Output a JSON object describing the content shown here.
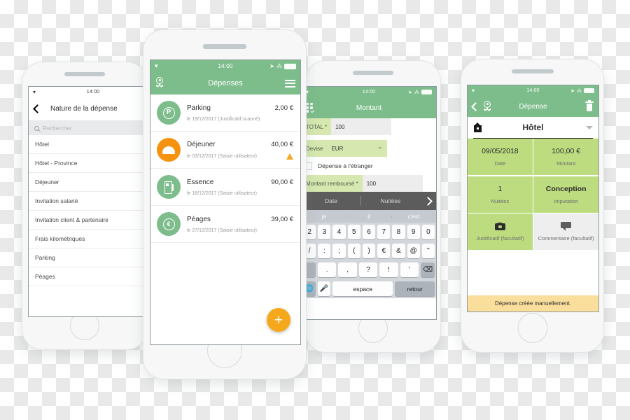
{
  "status_bar": {
    "time": "14:00",
    "wifi_icon": "wifi-icon",
    "location_icon": "location-arrow-icon",
    "bluetooth_icon": "bluetooth-icon",
    "battery_icon": "battery-full-icon"
  },
  "phone_nature": {
    "back_icon": "chevron-left-icon",
    "title": "Nature de la dépense",
    "search_icon": "search-icon",
    "search_placeholder": "Rechercher",
    "items": [
      {
        "label": "Hôtel"
      },
      {
        "label": "Hôtel - Province"
      },
      {
        "label": "Déjeuner"
      },
      {
        "label": "Invitation salarié"
      },
      {
        "label": "Invitation client & partenaire"
      },
      {
        "label": "Frais kilométriques"
      },
      {
        "label": "Parking"
      },
      {
        "label": "Péages"
      }
    ]
  },
  "phone_list": {
    "logo_icon": "app-logo-icon",
    "title": "Dépenses",
    "menu_icon": "hamburger-menu-icon",
    "add_button_label": "+",
    "add_button_icon": "plus-icon",
    "expenses": [
      {
        "icon": "parking-icon",
        "color": "#7dbd8b",
        "name": "Parking",
        "amount": "2,00 €",
        "detail": "le 19/12/2017  (Justificatif scanné)",
        "warning": false
      },
      {
        "icon": "meal-icon",
        "color": "#f59310",
        "name": "Déjeuner",
        "amount": "40,00 €",
        "detail": "le 03/12/2017  (Saisie utilisateur)",
        "warning": true
      },
      {
        "icon": "fuel-icon",
        "color": "#7dbd8b",
        "name": "Essence",
        "amount": "90,00 €",
        "detail": "le 18/12/2017  (Saisie utilisateur)",
        "warning": false
      },
      {
        "icon": "toll-euro-icon",
        "color": "#7dbd8b",
        "name": "Péages",
        "amount": "39,00 €",
        "detail": "le 27/12/2017  (Saisie utilisateur)",
        "warning": false
      }
    ]
  },
  "phone_montant": {
    "grid_icon": "grid-check-icon",
    "title": "Montant",
    "fields": [
      {
        "label": "TOTAL  *",
        "value": "100"
      },
      {
        "label": "Devise",
        "value": "EUR"
      },
      {
        "label": "Montant remboursé  *",
        "value": "100"
      }
    ],
    "checkbox_label": "Dépense à l'étranger",
    "segments": {
      "left": "Date",
      "right": "Nuitées",
      "next_icon": "chevron-right-icon"
    },
    "keyboard": {
      "suggestions": [
        "je",
        "il",
        "c'est"
      ],
      "row_numbers": [
        "2",
        "3",
        "4",
        "5",
        "6",
        "7",
        "8",
        "9",
        "0"
      ],
      "row_symbols": [
        "/",
        ":",
        ";",
        "(",
        ")",
        "€",
        "&",
        "@",
        "\""
      ],
      "row_punct": [
        ".",
        ",",
        "?",
        "!",
        "'"
      ],
      "backspace_icon": "backspace-icon",
      "globe_icon": "globe-icon",
      "mic_icon": "microphone-icon",
      "space_label": "espace",
      "return_label": "retour"
    }
  },
  "phone_depense": {
    "back_icon": "chevron-left-icon",
    "logo_icon": "app-logo-icon",
    "title": "Dépense",
    "delete_icon": "trash-icon",
    "type_icon": "hotel-icon",
    "type_label": "Hôtel",
    "dropdown_icon": "chevron-down-icon",
    "tiles": [
      {
        "value": "09/05/2018",
        "key": "Date",
        "style": "green",
        "bold": false
      },
      {
        "value": "100,00 €",
        "key": "Montant",
        "style": "green",
        "bold": false
      },
      {
        "value": "1",
        "key": "Nuitées",
        "style": "green",
        "bold": false
      },
      {
        "value": "Conception",
        "key": "Imputation",
        "style": "green",
        "bold": true
      }
    ],
    "action_tiles": [
      {
        "icon": "camera-icon",
        "key": "Justificatif (facultatif)",
        "style": "green"
      },
      {
        "icon": "comment-icon",
        "key": "Commentaire (facultatif)",
        "style": "grey"
      }
    ],
    "notice": "Dépense créée manuellement."
  },
  "colors": {
    "brand_green": "#7dbd8b",
    "tile_green": "#bddc80",
    "accent_orange": "#f5a81c",
    "notice_yellow": "#fade9c"
  }
}
